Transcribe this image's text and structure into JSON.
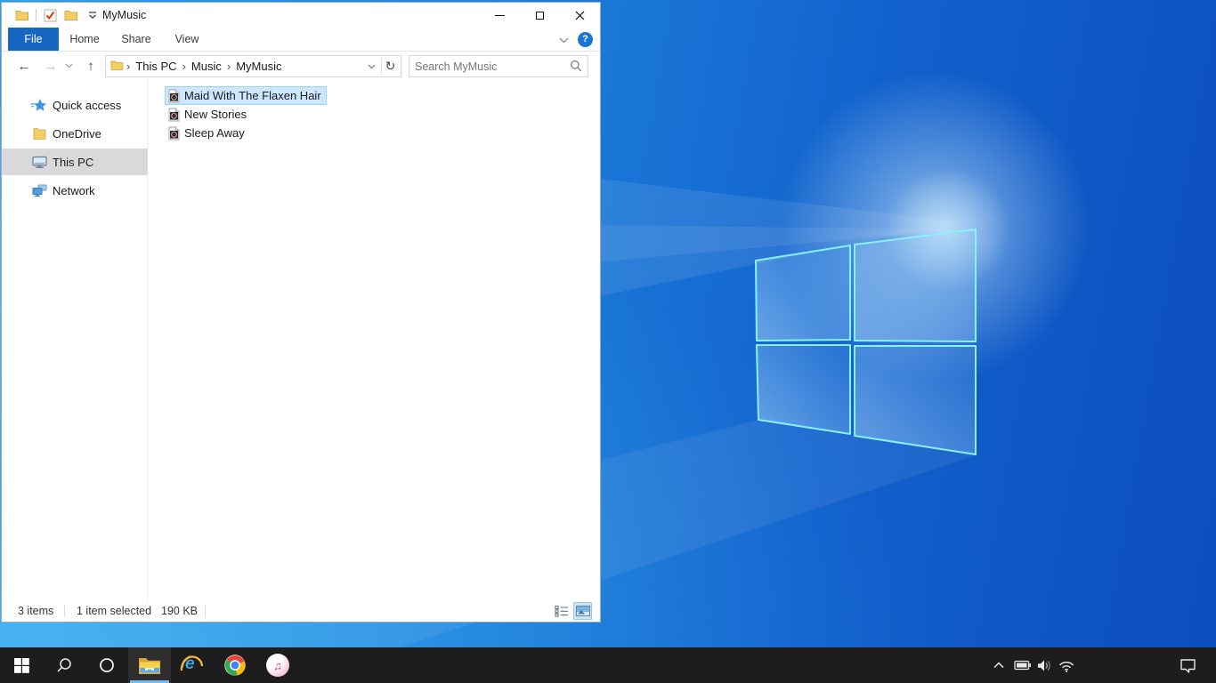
{
  "colors": {
    "accent_blue": "#1667c1",
    "selection_bg": "#cce8ff",
    "selection_border": "#99d1ff",
    "sidebar_selected_bg": "#d9d9d9",
    "taskbar_bg": "#1d1d1d",
    "taskbar_active_underline": "#76b9ed",
    "help_blue": "#1876d2"
  },
  "icons": {
    "back": "←",
    "forward": "→",
    "up": "↑",
    "refresh": "↻",
    "chevron_right": "›",
    "question": "?",
    "music_note": "♫",
    "ie_letter": "e"
  },
  "explorer": {
    "title": "MyMusic",
    "tabs": [
      {
        "label": "File"
      },
      {
        "label": "Home"
      },
      {
        "label": "Share"
      },
      {
        "label": "View"
      }
    ],
    "breadcrumb": [
      "This PC",
      "Music",
      "MyMusic"
    ],
    "search_placeholder": "Search MyMusic",
    "sidebar": [
      {
        "label": "Quick access"
      },
      {
        "label": "OneDrive"
      },
      {
        "label": "This PC"
      },
      {
        "label": "Network"
      }
    ],
    "files": [
      {
        "name": "Maid With The Flaxen Hair"
      },
      {
        "name": "New Stories"
      },
      {
        "name": "Sleep Away"
      }
    ],
    "status": {
      "item_count": "3 items",
      "selection": "1 item selected",
      "size": "190 KB"
    }
  }
}
